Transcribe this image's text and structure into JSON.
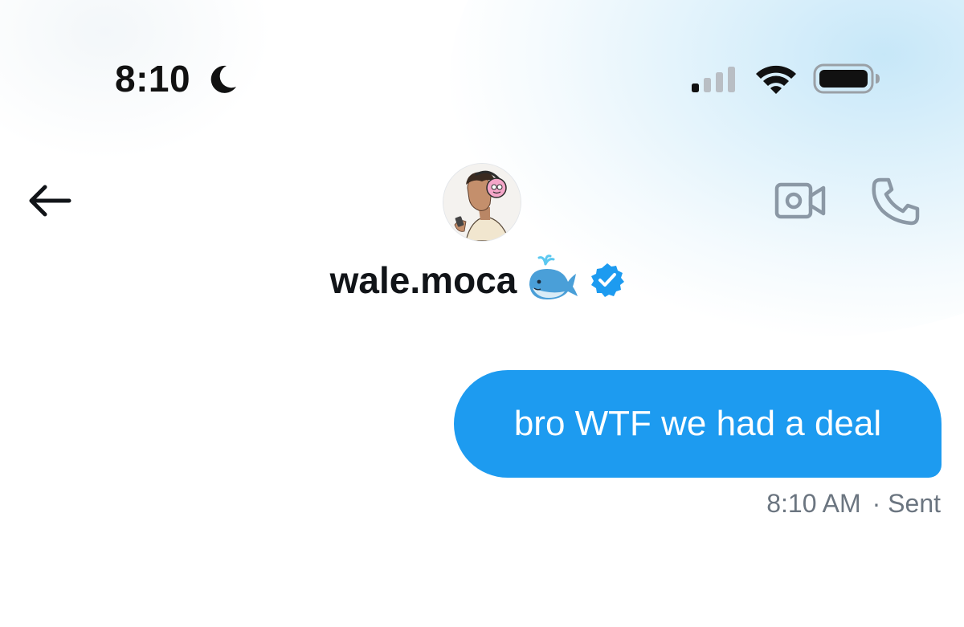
{
  "status_bar": {
    "time": "8:10",
    "focus_icon": "moon-icon",
    "signal_icon": "cellular-signal-icon",
    "wifi_icon": "wifi-icon",
    "battery_icon": "battery-icon",
    "signal_bars_active": 1,
    "signal_bars_total": 4
  },
  "header": {
    "back_icon": "arrow-left-icon",
    "contact_name": "wale.moca",
    "name_emoji_icon": "spouting-whale-icon",
    "verified_icon": "verified-badge-icon",
    "video_call_icon": "video-camera-icon",
    "voice_call_icon": "phone-icon"
  },
  "conversation": {
    "messages": [
      {
        "text": "bro WTF we had a deal",
        "direction": "outgoing",
        "time": "8:10 AM",
        "status": "· Sent"
      }
    ]
  },
  "colors": {
    "bubble": "#1d9bf0",
    "verified": "#1d9bf0",
    "icon_gray": "#8b98a5",
    "meta_text": "#6b7580"
  }
}
